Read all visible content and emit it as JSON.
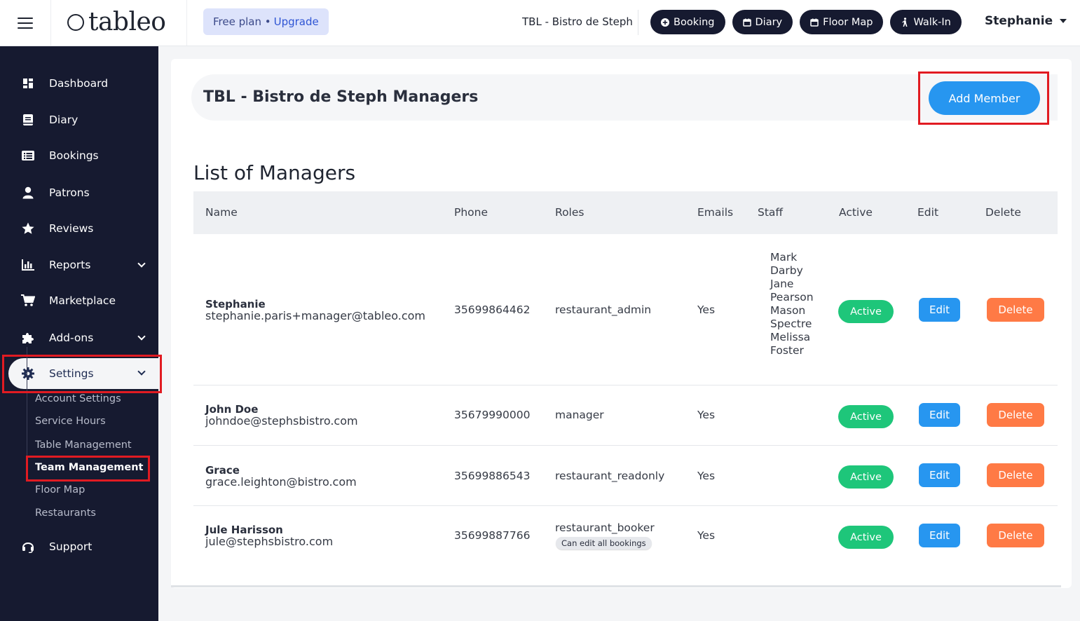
{
  "topbar": {
    "logo_text": "tableo",
    "plan_label": "Free plan •",
    "upgrade_label": "Upgrade",
    "venue": "TBL - Bistro de Steph",
    "actions": [
      {
        "label": "Booking",
        "icon": "plus-circle-icon"
      },
      {
        "label": "Diary",
        "icon": "calendar-icon"
      },
      {
        "label": "Floor Map",
        "icon": "calendar-icon"
      },
      {
        "label": "Walk-In",
        "icon": "walking-person-icon"
      }
    ],
    "user": "Stephanie"
  },
  "sidebar": {
    "items": [
      {
        "label": "Dashboard",
        "icon": "dashboard-icon"
      },
      {
        "label": "Diary",
        "icon": "book-icon"
      },
      {
        "label": "Bookings",
        "icon": "list-icon"
      },
      {
        "label": "Patrons",
        "icon": "user-icon"
      },
      {
        "label": "Reviews",
        "icon": "star-icon"
      },
      {
        "label": "Reports",
        "icon": "bar-chart-icon"
      },
      {
        "label": "Marketplace",
        "icon": "cart-icon"
      },
      {
        "label": "Add-ons",
        "icon": "puzzle-icon"
      },
      {
        "label": "Settings",
        "icon": "gear-icon"
      },
      {
        "label": "Support",
        "icon": "headset-icon"
      }
    ],
    "settings_sub": [
      "Account Settings",
      "Service Hours",
      "Table Management",
      "Team Management",
      "Floor Map",
      "Restaurants"
    ]
  },
  "main": {
    "page_title": "TBL - Bistro de Steph Managers",
    "add_button": "Add Member",
    "section_title": "List of Managers",
    "columns": [
      "Name",
      "Phone",
      "Roles",
      "Emails",
      "Staff",
      "Active",
      "Edit",
      "Delete"
    ],
    "rows": [
      {
        "name": "Stephanie",
        "email": "stephanie.paris+manager@tableo.com",
        "phone": "35699864462",
        "role": "restaurant_admin",
        "role_note": "",
        "emails": "Yes",
        "staff": [
          "Mark",
          "Darby",
          "Jane",
          "Pearson",
          "Mason",
          "Spectre",
          "Melissa",
          "Foster"
        ],
        "active": "Active",
        "edit": "Edit",
        "delete": "Delete"
      },
      {
        "name": "John Doe",
        "email": "johndoe@stephsbistro.com",
        "phone": "35679990000",
        "role": "manager",
        "role_note": "",
        "emails": "Yes",
        "staff": [],
        "active": "Active",
        "edit": "Edit",
        "delete": "Delete"
      },
      {
        "name": "Grace",
        "email": "grace.leighton@bistro.com",
        "phone": "35699886543",
        "role": "restaurant_readonly",
        "role_note": "",
        "emails": "Yes",
        "staff": [],
        "active": "Active",
        "edit": "Edit",
        "delete": "Delete"
      },
      {
        "name": "Jule Harisson",
        "email": "jule@stephsbistro.com",
        "phone": "35699887766",
        "role": "restaurant_booker",
        "role_note": "Can edit all bookings",
        "emails": "Yes",
        "staff": [],
        "active": "Active",
        "edit": "Edit",
        "delete": "Delete"
      }
    ]
  },
  "colors": {
    "sidebar_bg": "#161a30",
    "primary_blue": "#2796f0",
    "active_green": "#1ec67a",
    "delete_orange": "#ff7a45",
    "highlight_red": "#e11b22"
  }
}
